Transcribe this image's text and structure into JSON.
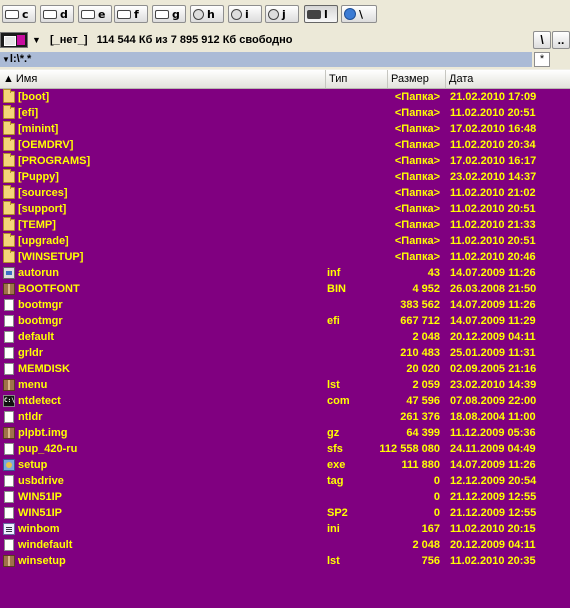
{
  "drives": [
    {
      "letter": "c",
      "icon": "hard-drive-icon"
    },
    {
      "letter": "d",
      "icon": "hard-drive-icon"
    },
    {
      "letter": "e",
      "icon": "hard-drive-icon"
    },
    {
      "letter": "f",
      "icon": "hard-drive-icon"
    },
    {
      "letter": "g",
      "icon": "hard-drive-icon"
    },
    {
      "letter": "h",
      "icon": "cd-drive-icon"
    },
    {
      "letter": "i",
      "icon": "cd-drive-icon"
    },
    {
      "letter": "j",
      "icon": "cd-drive-icon"
    },
    {
      "letter": "l",
      "icon": "removable-drive-icon",
      "active": true
    },
    {
      "letter": "\\",
      "icon": "network-globe-icon"
    }
  ],
  "info": {
    "label": "[_нет_]",
    "free_text": "114 544 Кб из 7 895 912 Кб свободно",
    "root_button": "\\",
    "up_button": ".."
  },
  "path": {
    "text": "l:\\*.*",
    "star_button": "*"
  },
  "columns": {
    "name": "Имя",
    "ext": "Тип",
    "size": "Размер",
    "date": "Дата"
  },
  "colors": {
    "list_background": "#800080",
    "list_text": "#ffff00",
    "path_highlight": "#abbbd6"
  },
  "files": [
    {
      "name": "[boot]",
      "ext": "",
      "size": "<Папка>",
      "date": "21.02.2010 17:09",
      "icon": "folder"
    },
    {
      "name": "[efi]",
      "ext": "",
      "size": "<Папка>",
      "date": "11.02.2010 20:51",
      "icon": "folder"
    },
    {
      "name": "[minint]",
      "ext": "",
      "size": "<Папка>",
      "date": "17.02.2010 16:48",
      "icon": "folder"
    },
    {
      "name": "[OEMDRV]",
      "ext": "",
      "size": "<Папка>",
      "date": "11.02.2010 20:34",
      "icon": "folder"
    },
    {
      "name": "[PROGRAMS]",
      "ext": "",
      "size": "<Папка>",
      "date": "17.02.2010 16:17",
      "icon": "folder"
    },
    {
      "name": "[Puppy]",
      "ext": "",
      "size": "<Папка>",
      "date": "23.02.2010 14:37",
      "icon": "folder"
    },
    {
      "name": "[sources]",
      "ext": "",
      "size": "<Папка>",
      "date": "11.02.2010 21:02",
      "icon": "folder"
    },
    {
      "name": "[support]",
      "ext": "",
      "size": "<Папка>",
      "date": "11.02.2010 20:51",
      "icon": "folder"
    },
    {
      "name": "[TEMP]",
      "ext": "",
      "size": "<Папка>",
      "date": "11.02.2010 21:33",
      "icon": "folder"
    },
    {
      "name": "[upgrade]",
      "ext": "",
      "size": "<Папка>",
      "date": "11.02.2010 20:51",
      "icon": "folder"
    },
    {
      "name": "[WINSETUP]",
      "ext": "",
      "size": "<Папка>",
      "date": "11.02.2010 20:46",
      "icon": "folder"
    },
    {
      "name": "autorun",
      "ext": "inf",
      "size": "43",
      "date": "14.07.2009 11:26",
      "icon": "sys"
    },
    {
      "name": "BOOTFONT",
      "ext": "BIN",
      "size": "4 952",
      "date": "26.03.2008 21:50",
      "icon": "pkg"
    },
    {
      "name": "bootmgr",
      "ext": "",
      "size": "383 562",
      "date": "14.07.2009 11:26",
      "icon": "file"
    },
    {
      "name": "bootmgr",
      "ext": "efi",
      "size": "667 712",
      "date": "14.07.2009 11:29",
      "icon": "file"
    },
    {
      "name": "default",
      "ext": "",
      "size": "2 048",
      "date": "20.12.2009 04:11",
      "icon": "file"
    },
    {
      "name": "grldr",
      "ext": "",
      "size": "210 483",
      "date": "25.01.2009 11:31",
      "icon": "file"
    },
    {
      "name": "MEMDISK",
      "ext": "",
      "size": "20 020",
      "date": "02.09.2005 21:16",
      "icon": "file"
    },
    {
      "name": "menu",
      "ext": "lst",
      "size": "2 059",
      "date": "23.02.2010 14:39",
      "icon": "pkg"
    },
    {
      "name": "ntdetect",
      "ext": "com",
      "size": "47 596",
      "date": "07.08.2009 22:00",
      "icon": "cmd"
    },
    {
      "name": "ntldr",
      "ext": "",
      "size": "261 376",
      "date": "18.08.2004 11:00",
      "icon": "file"
    },
    {
      "name": "plpbt.img",
      "ext": "gz",
      "size": "64 399",
      "date": "11.12.2009 05:36",
      "icon": "pkg"
    },
    {
      "name": "pup_420-ru",
      "ext": "sfs",
      "size": "112 558 080",
      "date": "24.11.2009 04:49",
      "icon": "file"
    },
    {
      "name": "setup",
      "ext": "exe",
      "size": "111 880",
      "date": "14.07.2009 11:26",
      "icon": "exe"
    },
    {
      "name": "usbdrive",
      "ext": "tag",
      "size": "0",
      "date": "12.12.2009 20:54",
      "icon": "file"
    },
    {
      "name": "WIN51IP",
      "ext": "",
      "size": "0",
      "date": "21.12.2009 12:55",
      "icon": "file"
    },
    {
      "name": "WIN51IP",
      "ext": "SP2",
      "size": "0",
      "date": "21.12.2009 12:55",
      "icon": "file"
    },
    {
      "name": "winbom",
      "ext": "ini",
      "size": "167",
      "date": "11.02.2010 20:15",
      "icon": "txt"
    },
    {
      "name": "windefault",
      "ext": "",
      "size": "2 048",
      "date": "20.12.2009 04:11",
      "icon": "file"
    },
    {
      "name": "winsetup",
      "ext": "lst",
      "size": "756",
      "date": "11.02.2010 20:35",
      "icon": "pkg"
    }
  ]
}
